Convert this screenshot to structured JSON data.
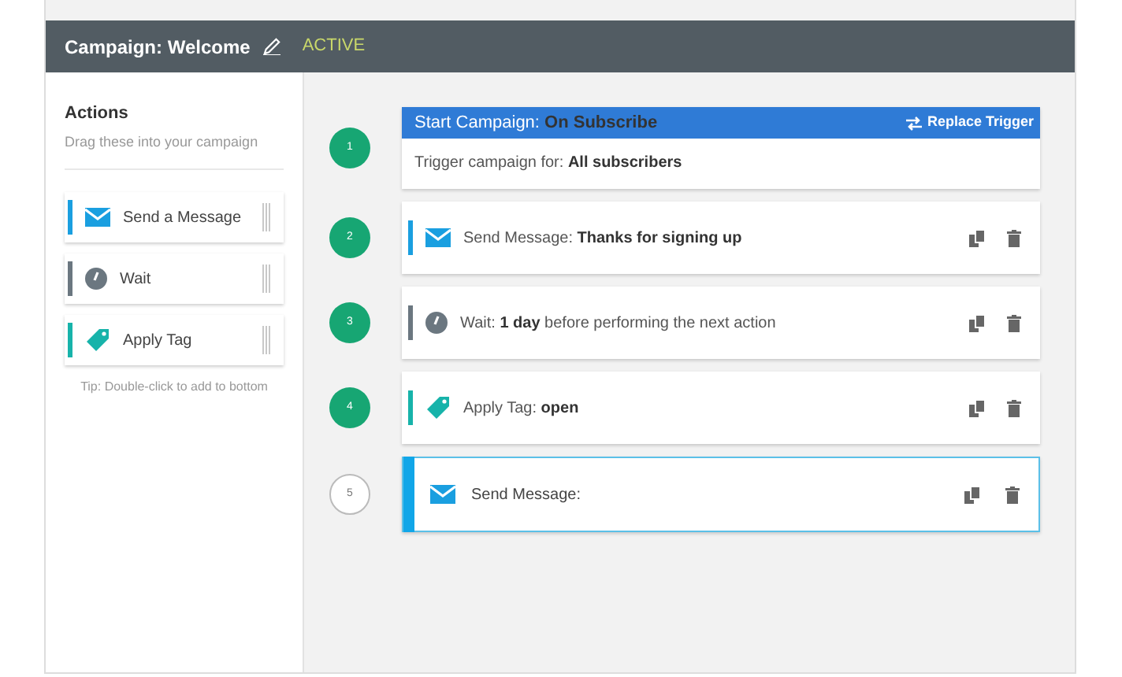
{
  "header": {
    "title": "Campaign: Welcome",
    "status": "ACTIVE"
  },
  "sidebar": {
    "title": "Actions",
    "subtitle": "Drag these into your campaign",
    "items": [
      {
        "kind": "message",
        "label": "Send a Message"
      },
      {
        "kind": "wait",
        "label": "Wait"
      },
      {
        "kind": "tag",
        "label": "Apply Tag"
      }
    ],
    "tip": "Tip: Double-click to add to bottom"
  },
  "steps": [
    {
      "number": "1",
      "completed": true,
      "kind": "trigger",
      "title": "Start Campaign: **On Subscribe**",
      "action": "Replace Trigger",
      "text": "Trigger campaign for: **All subscribers**"
    },
    {
      "number": "2",
      "completed": true,
      "kind": "message",
      "selected": false,
      "text": "Send Message: **Thanks for signing up**"
    },
    {
      "number": "3",
      "completed": true,
      "kind": "wait",
      "selected": false,
      "text": "Wait: **1 day** before performing the next action"
    },
    {
      "number": "4",
      "completed": true,
      "kind": "tag",
      "selected": false,
      "text": "Apply Tag: **open**"
    },
    {
      "number": "5",
      "completed": false,
      "kind": "message",
      "selected": true,
      "text": "Send Message:"
    }
  ]
}
